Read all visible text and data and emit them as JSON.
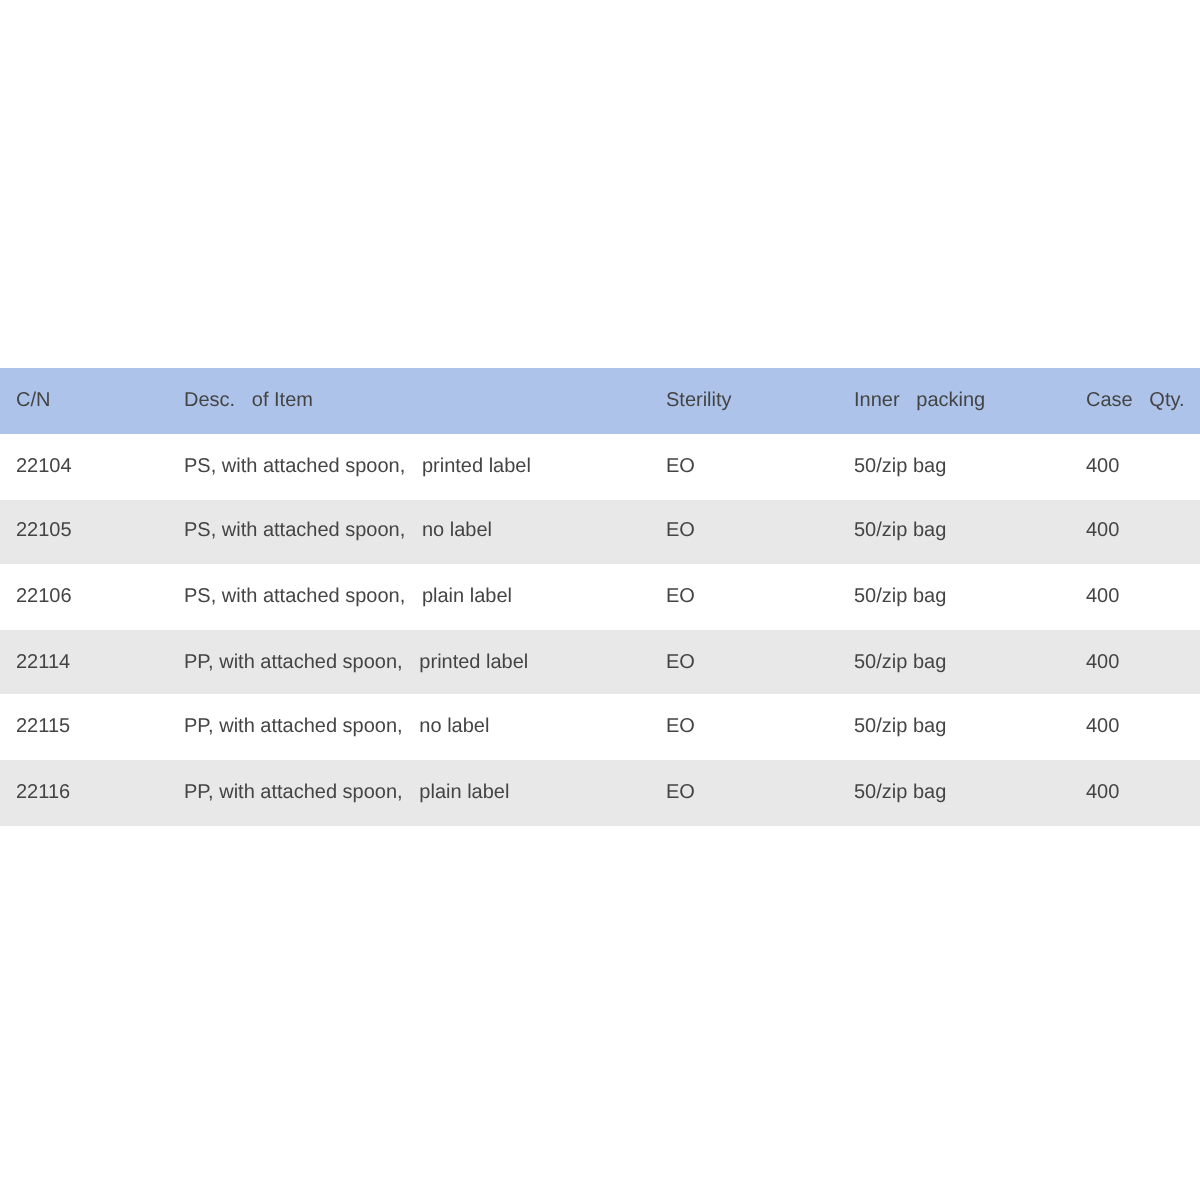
{
  "table": {
    "columns": [
      "C/N",
      "Desc.   of Item",
      "Sterility",
      "Inner   packing",
      "Case   Qty."
    ],
    "rows": [
      {
        "cells": [
          "22104",
          "PS, with attached spoon,   printed label",
          "EO",
          "50/zip bag",
          "400"
        ]
      },
      {
        "cells": [
          "22105",
          "PS, with attached spoon,   no label",
          "EO",
          "50/zip bag",
          "400"
        ]
      },
      {
        "cells": [
          "22106",
          "PS, with attached spoon,   plain label",
          "EO",
          "50/zip bag",
          "400"
        ]
      },
      {
        "cells": [
          "22114",
          "PP, with attached spoon,   printed label",
          "EO",
          "50/zip bag",
          "400"
        ]
      },
      {
        "cells": [
          "22115",
          "PP, with attached spoon,   no label",
          "EO",
          "50/zip bag",
          "400"
        ]
      },
      {
        "cells": [
          "22116",
          "PP, with attached spoon,   plain label",
          "EO",
          "50/zip bag",
          "400"
        ]
      }
    ]
  }
}
